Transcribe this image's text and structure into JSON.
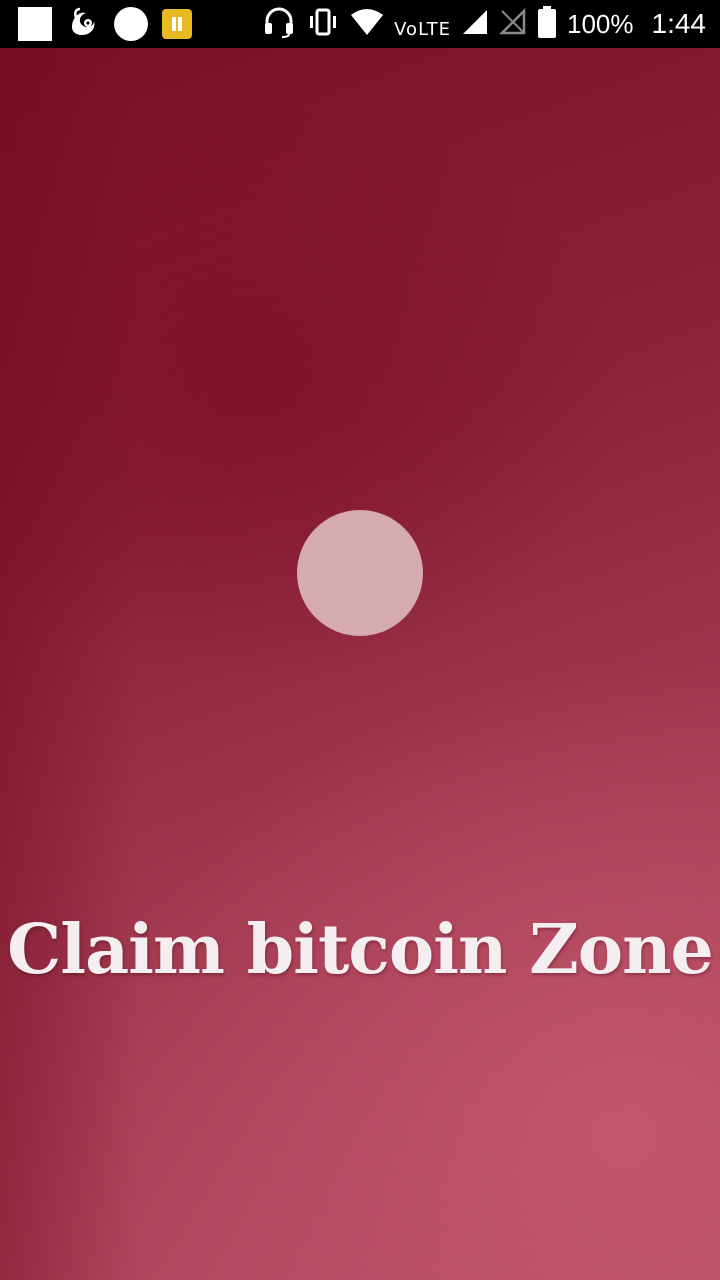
{
  "status_bar": {
    "notification_icons": [
      "image-icon",
      "uc-browser-icon",
      "circle-icon",
      "pause-icon"
    ],
    "system_icons": [
      "headset-icon",
      "vibrate-icon",
      "wifi-icon",
      "signal-icon",
      "signal-empty-icon",
      "battery-icon"
    ],
    "volte_label": "VoLTE",
    "battery_percent": "100%",
    "time": "1:44"
  },
  "splash": {
    "title": "Claim bitcoin Zone",
    "colors": {
      "background_dark": "#7a1025",
      "background_light": "#b84f66",
      "loader": "#d5aab1",
      "title_text": "#f4eef0"
    }
  }
}
